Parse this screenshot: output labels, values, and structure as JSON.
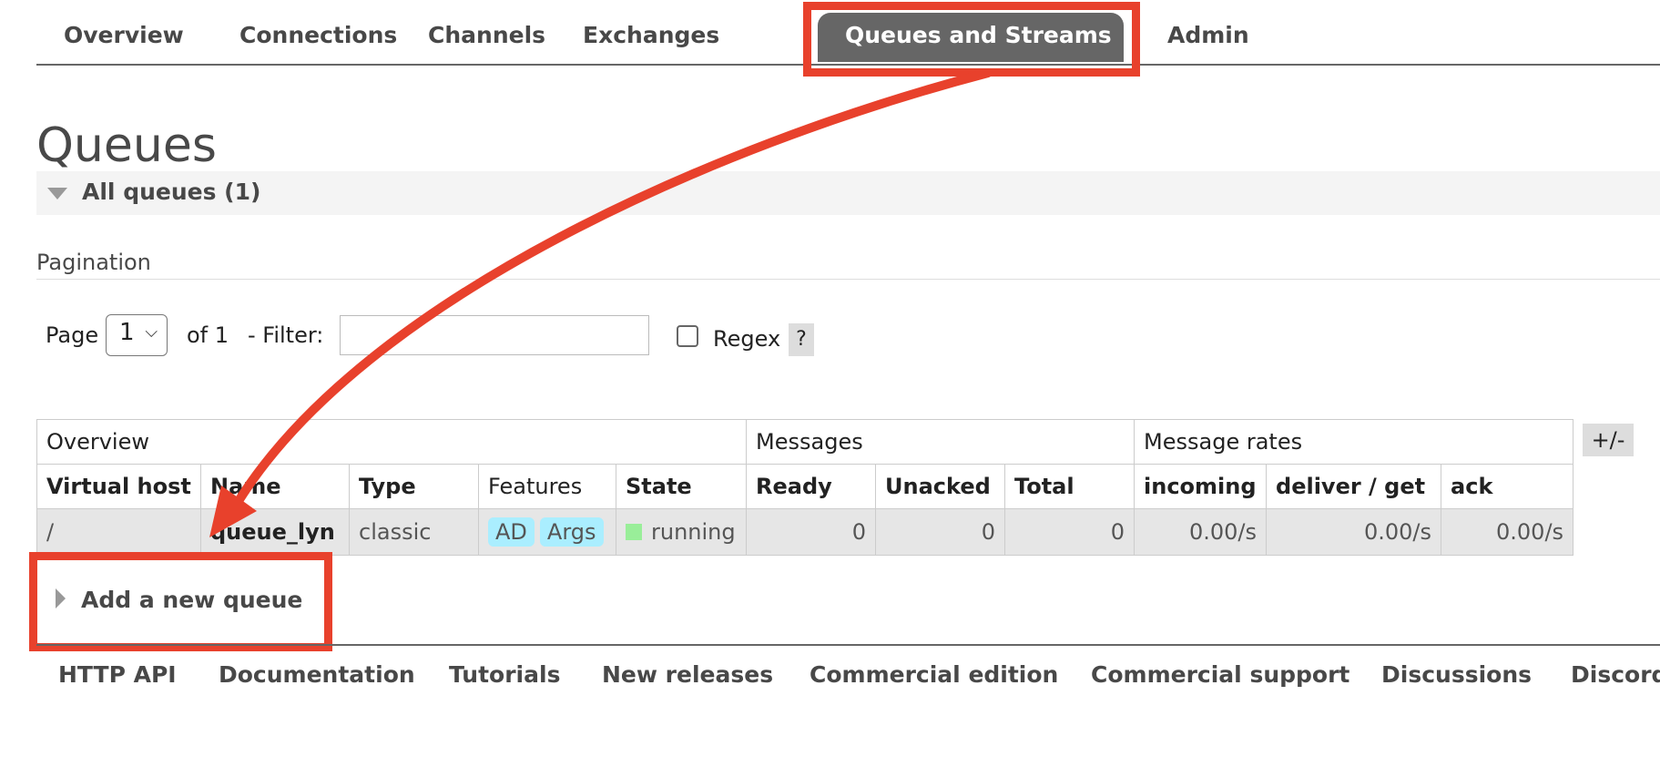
{
  "nav": {
    "tabs": [
      {
        "label": "Overview"
      },
      {
        "label": "Connections"
      },
      {
        "label": "Channels"
      },
      {
        "label": "Exchanges"
      },
      {
        "label": "Queues and Streams",
        "active": true
      },
      {
        "label": "Admin"
      }
    ]
  },
  "page": {
    "title": "Queues",
    "section_title": "All queues (1)"
  },
  "pagination": {
    "label": "Pagination",
    "page_label": "Page",
    "page_value": "1",
    "of_label": "of 1",
    "filter_label": "- Filter:",
    "filter_value": "",
    "regex_label": "Regex",
    "regex_checked": false,
    "help_label": "?"
  },
  "table": {
    "groups": [
      "Overview",
      "Messages",
      "Message rates"
    ],
    "columns": [
      "Virtual host",
      "Name",
      "Type",
      "Features",
      "State",
      "Ready",
      "Unacked",
      "Total",
      "incoming",
      "deliver / get",
      "ack"
    ],
    "rows": [
      {
        "vhost": "/",
        "name": "queue_lyn",
        "type": "classic",
        "features": [
          "AD",
          "Args"
        ],
        "state": "running",
        "ready": "0",
        "unacked": "0",
        "total": "0",
        "incoming": "0.00/s",
        "deliver_get": "0.00/s",
        "ack": "0.00/s"
      }
    ],
    "toggle_label": "+/-"
  },
  "add_queue": {
    "label": "Add a new queue"
  },
  "footer": {
    "links": [
      "HTTP API",
      "Documentation",
      "Tutorials",
      "New releases",
      "Commercial edition",
      "Commercial support",
      "Discussions",
      "Discord"
    ]
  },
  "colors": {
    "annotation": "#e8412c",
    "active_tab_bg": "#666666",
    "badge_bg": "#aaeeff",
    "running_dot": "#99ee99"
  }
}
